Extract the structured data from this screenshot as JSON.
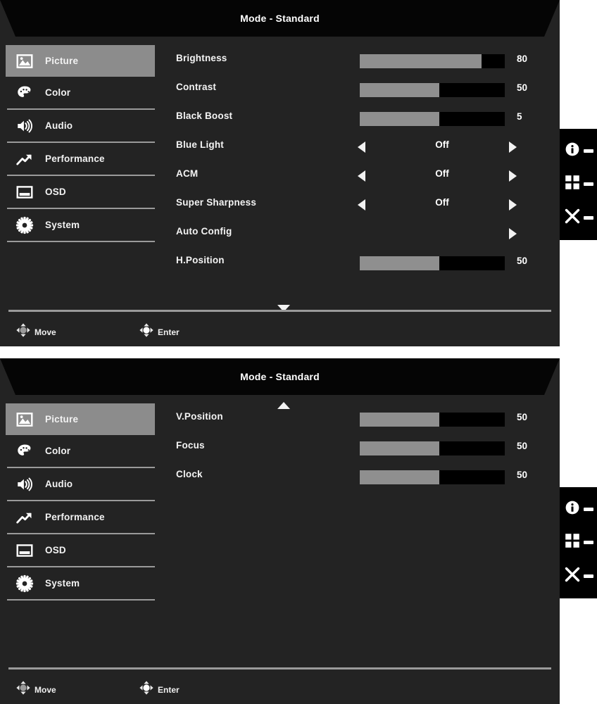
{
  "panels": [
    {
      "title": "Mode - Standard",
      "scroll_indicator": "down",
      "sidebar": [
        {
          "label": "Picture",
          "icon": "picture-icon",
          "active": true,
          "divider_after": false
        },
        {
          "label": "Color",
          "icon": "palette-icon",
          "active": false,
          "divider_after": true
        },
        {
          "label": "Audio",
          "icon": "speaker-icon",
          "active": false,
          "divider_after": true
        },
        {
          "label": "Performance",
          "icon": "trend-up-icon",
          "active": false,
          "divider_after": true
        },
        {
          "label": "OSD",
          "icon": "osd-window-icon",
          "active": false,
          "divider_after": true
        },
        {
          "label": "System",
          "icon": "gear-icon",
          "active": false,
          "divider_after": true
        }
      ],
      "rows": [
        {
          "label": "Brightness",
          "type": "slider",
          "value": "80",
          "fill_percent": 84
        },
        {
          "label": "Contrast",
          "type": "slider",
          "value": "50",
          "fill_percent": 55
        },
        {
          "label": "Black Boost",
          "type": "slider",
          "value": "5",
          "fill_percent": 55
        },
        {
          "label": "Blue Light",
          "type": "option",
          "value": "Off",
          "left_arrow": true,
          "right_arrow": true
        },
        {
          "label": "ACM",
          "type": "option",
          "value": "Off",
          "left_arrow": true,
          "right_arrow": true
        },
        {
          "label": "Super Sharpness",
          "type": "option",
          "value": "Off",
          "left_arrow": true,
          "right_arrow": true
        },
        {
          "label": "Auto Config",
          "type": "action",
          "value": "",
          "left_arrow": false,
          "right_arrow": true
        },
        {
          "label": "H.Position",
          "type": "slider",
          "value": "50",
          "fill_percent": 55
        }
      ],
      "footer": {
        "move_label": "Move",
        "enter_label": "Enter"
      },
      "icon_strip": [
        {
          "icon": "info-icon"
        },
        {
          "icon": "grid-icon"
        },
        {
          "icon": "close-x-icon"
        }
      ]
    },
    {
      "title": "Mode - Standard",
      "scroll_indicator": "up",
      "sidebar": [
        {
          "label": "Picture",
          "icon": "picture-icon",
          "active": true,
          "divider_after": false
        },
        {
          "label": "Color",
          "icon": "palette-icon",
          "active": false,
          "divider_after": true
        },
        {
          "label": "Audio",
          "icon": "speaker-icon",
          "active": false,
          "divider_after": true
        },
        {
          "label": "Performance",
          "icon": "trend-up-icon",
          "active": false,
          "divider_after": true
        },
        {
          "label": "OSD",
          "icon": "osd-window-icon",
          "active": false,
          "divider_after": true
        },
        {
          "label": "System",
          "icon": "gear-icon",
          "active": false,
          "divider_after": true
        }
      ],
      "rows": [
        {
          "label": "V.Position",
          "type": "slider",
          "value": "50",
          "fill_percent": 55
        },
        {
          "label": "Focus",
          "type": "slider",
          "value": "50",
          "fill_percent": 55
        },
        {
          "label": "Clock",
          "type": "slider",
          "value": "50",
          "fill_percent": 55
        }
      ],
      "footer": {
        "move_label": "Move",
        "enter_label": "Enter"
      },
      "icon_strip": [
        {
          "icon": "info-icon"
        },
        {
          "icon": "grid-icon"
        },
        {
          "icon": "close-x-icon"
        }
      ]
    }
  ],
  "colors": {
    "panel_bg": "#232323",
    "header_bg": "#050505",
    "highlight": "#8c8c8c",
    "slider_track": "#000000",
    "slider_fill": "#8f8f8f",
    "text": "#f4f4f4",
    "divider": "#9a9a9a",
    "strip_bg": "#000000"
  }
}
